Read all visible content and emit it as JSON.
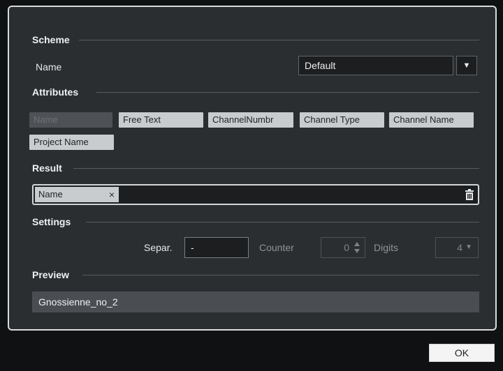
{
  "scheme": {
    "title": "Scheme",
    "name_label": "Name",
    "selected": "Default"
  },
  "attributes": {
    "title": "Attributes",
    "items": [
      "Name",
      "Free Text",
      "ChannelNumbr",
      "Channel Type",
      "Channel Name",
      "Project Name"
    ]
  },
  "result": {
    "title": "Result",
    "chip": "Name",
    "chip_remove": "×"
  },
  "settings": {
    "title": "Settings",
    "separator_label": "Separ.",
    "separator_value": "-",
    "counter_label": "Counter",
    "counter_value": "0",
    "digits_label": "Digits",
    "digits_value": "4"
  },
  "preview": {
    "title": "Preview",
    "value": "Gnossienne_no_2"
  },
  "footer": {
    "ok_label": "OK"
  }
}
